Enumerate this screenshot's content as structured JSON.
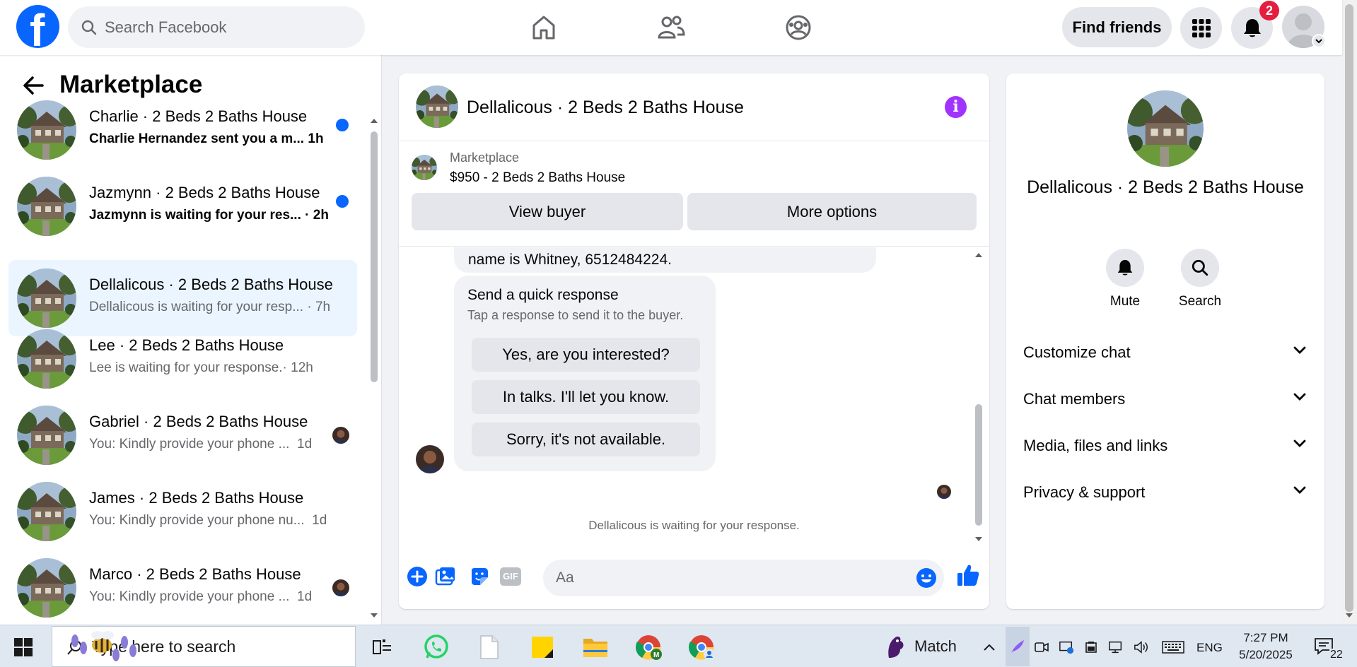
{
  "topbar": {
    "logo_letter": "f",
    "search_placeholder": "Search Facebook",
    "find_friends_label": "Find friends",
    "notification_count": "2",
    "icons": [
      "home-icon",
      "friends-icon",
      "groups-icon",
      "menu-grid-icon",
      "bell-icon",
      "account-avatar"
    ]
  },
  "left_pane": {
    "title": "Marketplace",
    "conversations": [
      {
        "title": "Charlie · 2 Beds 2 Baths House",
        "preview": "Charlie Hernandez sent you a m...",
        "time": "1h",
        "unread": true
      },
      {
        "title": "Jazmynn · 2 Beds 2 Baths House",
        "preview": "Jazmynn is waiting for your res...",
        "time": "· 2h",
        "unread": true
      },
      {
        "title": "Dellalicous · 2 Beds 2 Baths House",
        "preview": "Dellalicous is waiting for your resp...",
        "time": "· 7h",
        "active": true
      },
      {
        "title": "Lee · 2 Beds 2 Baths House",
        "preview": "Lee is waiting for your response.",
        "time": "· 12h"
      },
      {
        "title": "Gabriel · 2 Beds 2 Baths House",
        "preview": "You: Kindly provide your phone ...",
        "time": "1d"
      },
      {
        "title": "James · 2 Beds 2 Baths House",
        "preview": "You: Kindly provide your phone nu...",
        "time": "1d"
      },
      {
        "title": "Marco · 2 Beds 2 Baths House",
        "preview": "You: Kindly provide your phone ...",
        "time": "1d"
      }
    ]
  },
  "chat": {
    "title": "Dellalicous · 2 Beds 2 Baths House",
    "listing_label": "Marketplace",
    "listing_price": "$950 - 2 Beds 2 Baths House",
    "view_buyer_label": "View buyer",
    "more_options_label": "More options",
    "prev_message": "name is Whitney, 6512484224.",
    "quick_title": "Send a quick response",
    "quick_sub": "Tap a response to send it to the buyer.",
    "quick_responses": [
      "Yes, are you interested?",
      "In talks. I'll let you know.",
      "Sorry, it's not available."
    ],
    "waiting_note": "Dellalicous is waiting for your response.",
    "input_placeholder": "Aa",
    "gif_label": "GIF"
  },
  "info_panel": {
    "name": "Dellalicous · 2 Beds 2 Baths House",
    "mute_label": "Mute",
    "search_label": "Search",
    "sections": [
      "Customize chat",
      "Chat members",
      "Media, files and links",
      "Privacy & support"
    ]
  },
  "taskbar": {
    "search_placeholder": "Type here to search",
    "weather_label": "Match",
    "language": "ENG",
    "time": "7:27 PM",
    "date": "5/20/2025",
    "notification_count": "22"
  },
  "colors": {
    "fb_blue": "#0866ff",
    "active_row": "#ebf5ff",
    "info_purple": "#a033ff",
    "badge_red": "#e41e3f"
  }
}
